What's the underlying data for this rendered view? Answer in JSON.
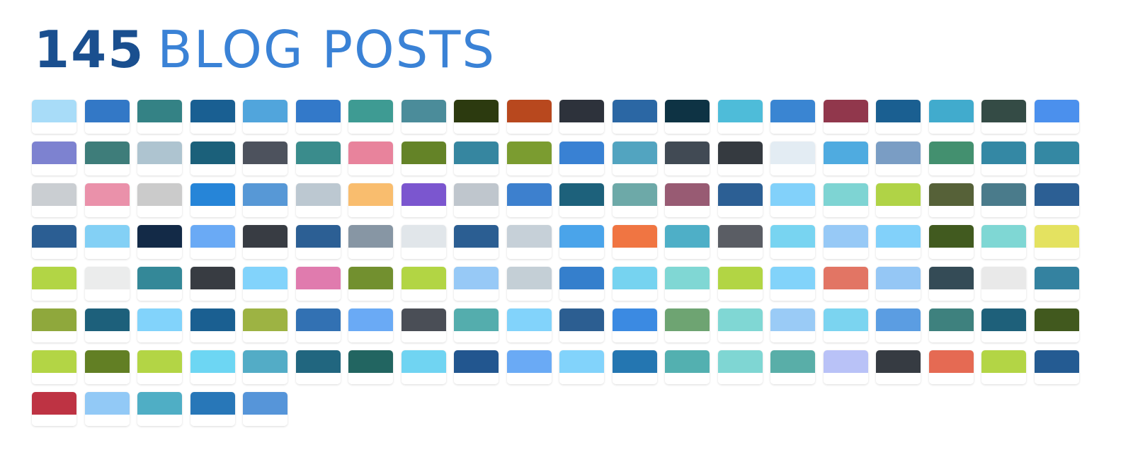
{
  "header": {
    "count": "145",
    "label": "BLOG POSTS",
    "count_color": "#1a4f8f",
    "label_color": "#3a82d6"
  },
  "posts": [
    "#a8dcf8",
    "#3378c6",
    "#348285",
    "#195f92",
    "#51a5dc",
    "#3379c9",
    "#3e9b93",
    "#4b8c9a",
    "#2c3a0f",
    "#b8481e",
    "#2d323b",
    "#2b67a4",
    "#0e3344",
    "#4ebcd9",
    "#3a85d2",
    "#91374c",
    "#1a5f91",
    "#41abcd",
    "#344b45",
    "#4b90ed",
    "#7d82d0",
    "#3e7d7a",
    "#aec4d0",
    "#1b607a",
    "#4d525d",
    "#3a8c8c",
    "#e8839c",
    "#648327",
    "#3686a0",
    "#7b9c30",
    "#3981d3",
    "#52a4c0",
    "#414a54",
    "#353a40",
    "#e3ecf3",
    "#4fabe0",
    "#7a9dc4",
    "#43906f",
    "#3488a4",
    "#3488a3",
    "#caced2",
    "#ea91aa",
    "#cbcbcb",
    "#2685d8",
    "#5798d6",
    "#bcc8d1",
    "#f9bd6e",
    "#7b56cf",
    "#bfc6cd",
    "#3d80ce",
    "#1d617b",
    "#6da9a8",
    "#985b73",
    "#2c5f94",
    "#82d1fa",
    "#7ed4d3",
    "#b0d346",
    "#566138",
    "#4a7b8b",
    "#2c5f94",
    "#2b5e93",
    "#83d0f5",
    "#132a47",
    "#6aaaf5",
    "#383c43",
    "#2c5f94",
    "#8796a4",
    "#e1e6ea",
    "#2b5e92",
    "#c6d0d8",
    "#4aa4ea",
    "#f07542",
    "#4eafc7",
    "#5a5d64",
    "#78d4f1",
    "#97c9f6",
    "#82d1fa",
    "#415a1f",
    "#7fd7d4",
    "#e4e260",
    "#b2d545",
    "#ebecec",
    "#348898",
    "#383c42",
    "#82d3fb",
    "#e07bae",
    "#72902f",
    "#b2d544",
    "#97c9f6",
    "#c4cfd6",
    "#357fcc",
    "#76d3f0",
    "#80d7d4",
    "#b2d544",
    "#82d3fa",
    "#e27564",
    "#95c7f5",
    "#344b56",
    "#e9e9e9",
    "#3482a0",
    "#8fa83c",
    "#1d607b",
    "#82d3fb",
    "#1a5f91",
    "#9db343",
    "#3271b3",
    "#6aaaf5",
    "#4a4e56",
    "#54adad",
    "#82d3fb",
    "#2c5e91",
    "#3b8ae2",
    "#6ea472",
    "#80d7d4",
    "#9acbf6",
    "#7bd4f0",
    "#5b9de2",
    "#3e817e",
    "#1e607a",
    "#41591e",
    "#b3d545",
    "#627f24",
    "#b3d545",
    "#6dd6f3",
    "#53acc6",
    "#21667f",
    "#226561",
    "#70d4f2",
    "#22568f",
    "#6aaaf5",
    "#82d3fb",
    "#2476b1",
    "#53b0b0",
    "#7fd6d3",
    "#59aea8",
    "#b9c2f7",
    "#363b42",
    "#e56a53",
    "#b3d545",
    "#245b92",
    "#be3343",
    "#92c9f6",
    "#4faec5",
    "#2877b8",
    "#5695d9"
  ]
}
